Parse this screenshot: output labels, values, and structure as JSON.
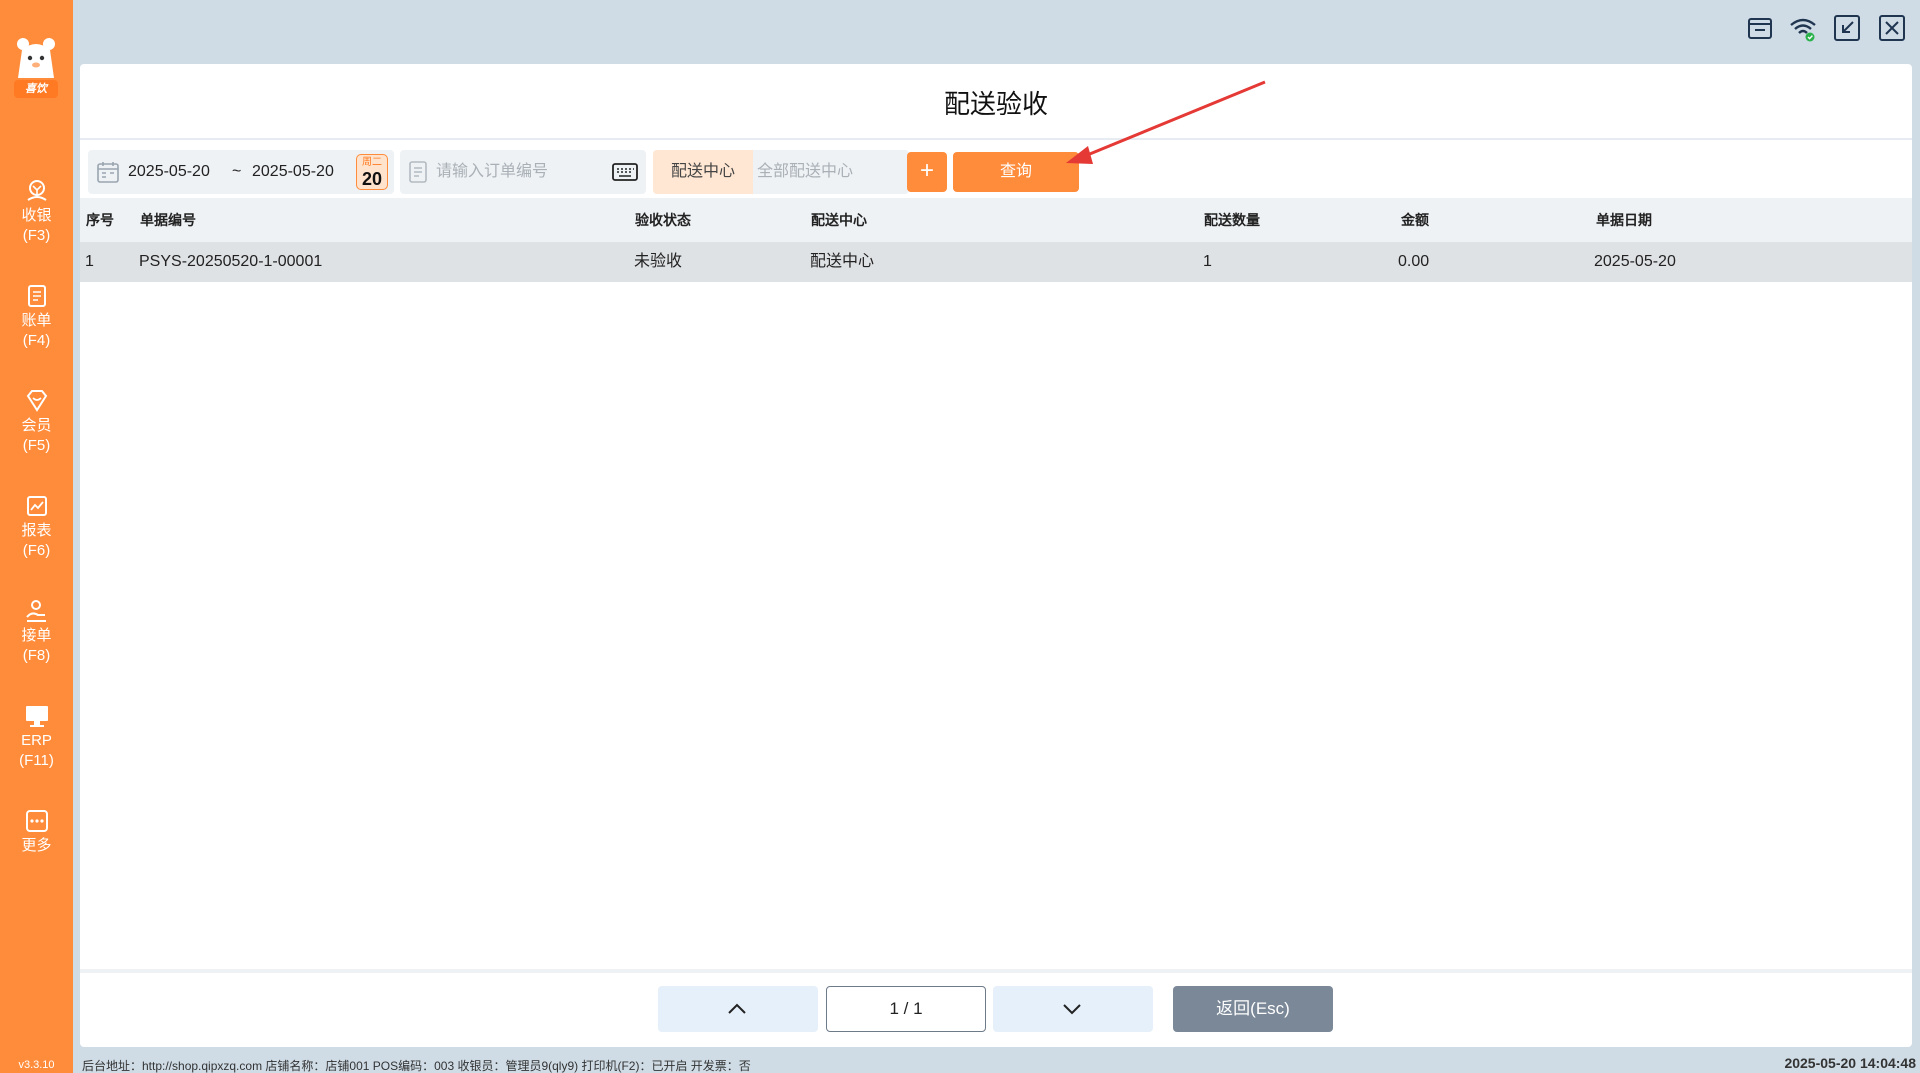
{
  "app": {
    "logo_text": "喜饮",
    "version": "v3.3.10"
  },
  "sidebar": {
    "items": [
      {
        "label": "收银",
        "key": "(F3)",
        "icon": "cashier-icon"
      },
      {
        "label": "账单",
        "key": "(F4)",
        "icon": "bill-icon"
      },
      {
        "label": "会员",
        "key": "(F5)",
        "icon": "member-icon"
      },
      {
        "label": "报表",
        "key": "(F6)",
        "icon": "report-icon"
      },
      {
        "label": "接单",
        "key": "(F8)",
        "icon": "order-receive-icon"
      },
      {
        "label": "ERP",
        "key": "(F11)",
        "icon": "erp-icon"
      },
      {
        "label": "更多",
        "key": "",
        "icon": "more-icon"
      }
    ]
  },
  "window_controls": [
    "store-icon",
    "wifi-icon",
    "shrink-icon",
    "close-icon"
  ],
  "page": {
    "title": "配送验收"
  },
  "filters": {
    "date_start": "2025-05-20",
    "date_sep": "~",
    "date_end": "2025-05-20",
    "weekday": "周二",
    "day": "20",
    "order_placeholder": "请输入订单编号",
    "center_label": "配送中心",
    "center_value": "全部配送中心",
    "plus": "+",
    "query_label": "查询"
  },
  "table": {
    "headers": [
      "序号",
      "单据编号",
      "验收状态",
      "配送中心",
      "配送数量",
      "金额",
      "单据日期"
    ],
    "rows": [
      [
        "1",
        "PSYS-20250520-1-00001",
        "未验收",
        "配送中心",
        "1",
        "0.00",
        "2025-05-20"
      ]
    ]
  },
  "pagination": {
    "page": "1 / 1",
    "back_label": "返回(Esc)"
  },
  "status_bar": {
    "text": "后台地址：http://shop.qipxzq.com  店铺名称：店铺001  POS编码：003  收银员：管理员9(qly9)  打印机(F2)：已开启  开发票：否",
    "clock": "2025-05-20 14:04:48"
  },
  "colors": {
    "brand": "#ff8c3a",
    "panel_bg": "#ffffff",
    "app_bg": "#cfdce6",
    "back_button": "#7b8898",
    "annotation_arrow": "#e53935"
  }
}
